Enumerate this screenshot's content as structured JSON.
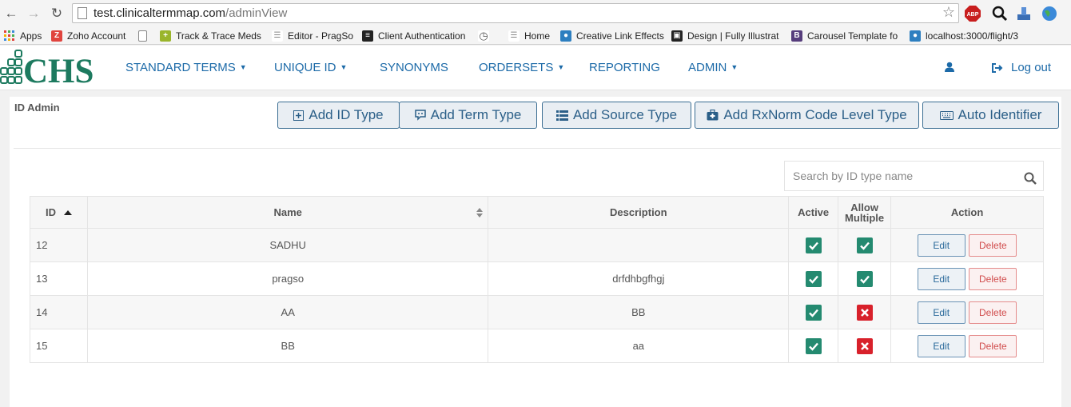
{
  "browser": {
    "url_host": "test.clinicaltermmap.com",
    "url_path": "/adminView",
    "bookmarks": [
      {
        "label": "Apps",
        "color": "#e0443e"
      },
      {
        "label": "Zoho Account",
        "color": "#e0443e"
      },
      {
        "label": "",
        "color": "#888888"
      },
      {
        "label": "Track & Trace Meds",
        "color": "#9ab52b"
      },
      {
        "label": "Editor - PragSo",
        "color": "#888888"
      },
      {
        "label": "Client Authentication",
        "color": "#222222"
      },
      {
        "label": "",
        "color": "#666666"
      },
      {
        "label": "Home",
        "color": "#888888"
      },
      {
        "label": "Creative Link Effects",
        "color": "#2d7fc0"
      },
      {
        "label": "Design | Fully Illustrat",
        "color": "#222222"
      },
      {
        "label": "Carousel Template fo",
        "color": "#563d7c"
      },
      {
        "label": "localhost:3000/flight/3",
        "color": "#2d7fc0"
      }
    ]
  },
  "app": {
    "logo_text": "CHS",
    "nav": {
      "standard_terms": "STANDARD TERMS",
      "unique_id": "UNIQUE ID",
      "synonyms": "SYNONYMS",
      "ordersets": "ORDERSETS",
      "reporting": "REPORTING",
      "admin": "ADMIN",
      "logout": "Log out"
    },
    "brand_color": "#1c6aa8",
    "logo_color": "#1d7a5f"
  },
  "panel": {
    "title": "ID Admin",
    "buttons": {
      "add_id_type": "Add ID Type",
      "add_term_type": "Add Term Type",
      "add_source_type": "Add Source Type",
      "add_rxnorm": "Add RxNorm Code Level Type",
      "auto_identifier": "Auto Identifier"
    },
    "search_placeholder": "Search by ID type name"
  },
  "table": {
    "headers": {
      "id": "ID",
      "name": "Name",
      "description": "Description",
      "active": "Active",
      "allow_multiple_1": "Allow",
      "allow_multiple_2": "Multiple",
      "action": "Action"
    },
    "edit_label": "Edit",
    "delete_label": "Delete",
    "rows": [
      {
        "id": "12",
        "name": "SADHU",
        "description": "",
        "active": true,
        "allow_multiple": true
      },
      {
        "id": "13",
        "name": "pragso",
        "description": "drfdhbgfhgj",
        "active": true,
        "allow_multiple": true
      },
      {
        "id": "14",
        "name": "AA",
        "description": "BB",
        "active": true,
        "allow_multiple": false
      },
      {
        "id": "15",
        "name": "BB",
        "description": "aa",
        "active": true,
        "allow_multiple": false
      }
    ]
  }
}
